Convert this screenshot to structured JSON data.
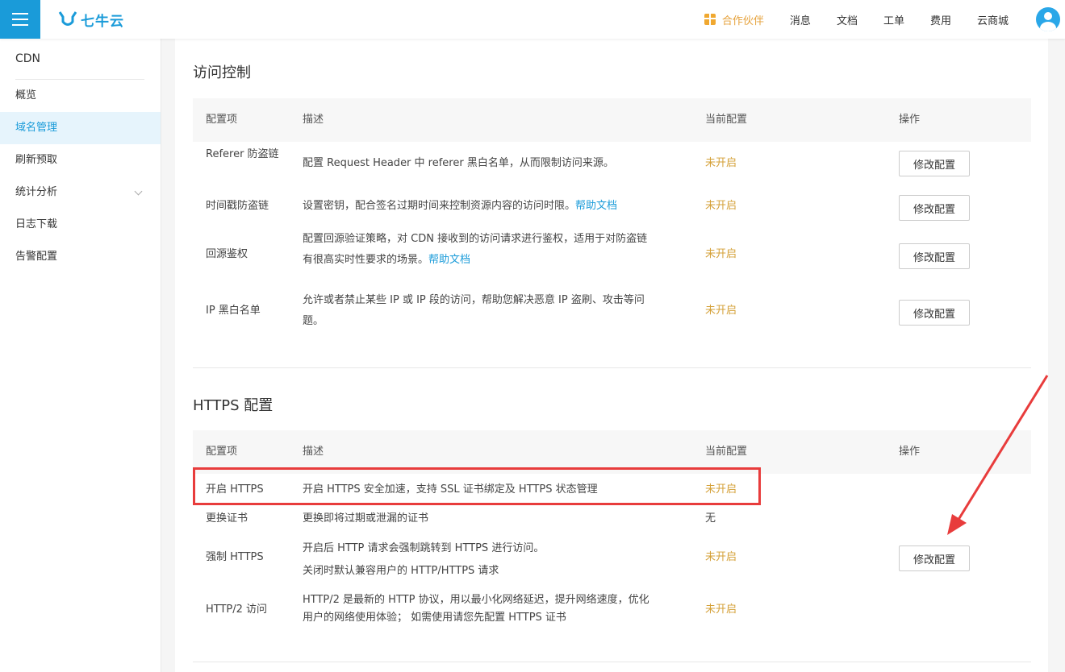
{
  "brand": {
    "name": "七牛云",
    "color": "#1a9bd9"
  },
  "topnav": {
    "partner": "合作伙伴",
    "items": [
      "消息",
      "文档",
      "工单",
      "费用",
      "云商城"
    ]
  },
  "sidebar": {
    "product": "CDN",
    "items": [
      {
        "label": "概览"
      },
      {
        "label": "域名管理",
        "active": true
      },
      {
        "label": "刷新预取"
      },
      {
        "label": "统计分析",
        "expandable": true
      },
      {
        "label": "日志下载"
      },
      {
        "label": "告警配置"
      }
    ]
  },
  "access": {
    "title": "访问控制",
    "headers": {
      "item": "配置项",
      "desc": "描述",
      "current": "当前配置",
      "op": "操作"
    },
    "rows": [
      {
        "name": "Referer 防盗链",
        "desc": "配置 Request Header 中 referer 黑白名单，从而限制访问来源。",
        "status": "未开启",
        "button": "修改配置"
      },
      {
        "name": "时间戳防盗链",
        "desc": "设置密钥，配合签名过期时间来控制资源内容的访问时限。",
        "link": "帮助文档",
        "status": "未开启",
        "button": "修改配置"
      },
      {
        "name": "回源鉴权",
        "desc_line1": "配置回源验证策略，对 CDN 接收到的访问请求进行鉴权，适用于对防盗链",
        "desc_line2": "有很高实时性要求的场景。",
        "link": "帮助文档",
        "status": "未开启",
        "button": "修改配置"
      },
      {
        "name": "IP 黑白名单",
        "desc_line1": "允许或者禁止某些 IP 或 IP 段的访问，帮助您解决恶意 IP 盗刷、攻击等问",
        "desc_line2": "题。",
        "status": "未开启",
        "button": "修改配置"
      }
    ]
  },
  "https": {
    "title": "HTTPS 配置",
    "headers": {
      "item": "配置项",
      "desc": "描述",
      "current": "当前配置",
      "op": "操作"
    },
    "rows": [
      {
        "name": "开启 HTTPS",
        "desc": "开启 HTTPS 安全加速，支持 SSL 证书绑定及 HTTPS 状态管理",
        "status": "未开启"
      },
      {
        "name": "更换证书",
        "desc": "更换即将过期或泄漏的证书",
        "status": "无"
      },
      {
        "name": "强制 HTTPS",
        "desc_line1": "开启后 HTTP 请求会强制跳转到 HTTPS 进行访问。",
        "desc_line2": "关闭时默认兼容用户的 HTTP/HTTPS 请求",
        "status": "未开启"
      },
      {
        "name": "HTTP/2 访问",
        "desc_line1": "HTTP/2 是最新的 HTTP 协议，用以最小化网络延迟，提升网络速度，优化",
        "desc_line2": "用户的网络使用体验； 如需使用请您先配置 HTTPS 证书",
        "status": "未开启"
      }
    ],
    "button": "修改配置"
  },
  "colors": {
    "status": "#d4a037",
    "annotation": "#e83c3c",
    "active_bg": "#e6f4fc"
  }
}
